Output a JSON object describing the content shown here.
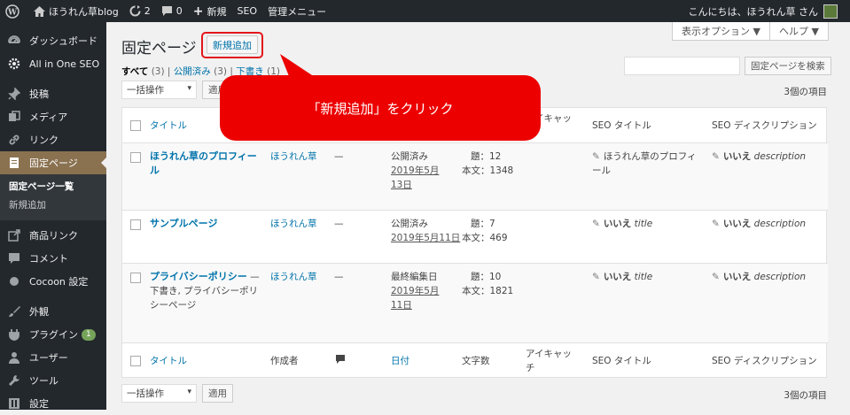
{
  "adminbar": {
    "site_name": "ほうれん草blog",
    "updates": "2",
    "comments": "0",
    "new_label": "新規",
    "seo": "SEO",
    "manage_menu": "管理メニュー",
    "greeting": "こんにちは、ほうれん草 さん"
  },
  "menu": {
    "items": [
      {
        "label": "ダッシュボード",
        "icon": "dashboard-icon"
      },
      {
        "label": "All in One SEO",
        "icon": "gear-icon"
      },
      {
        "label": "投稿",
        "icon": "pin-icon"
      },
      {
        "label": "メディア",
        "icon": "media-icon"
      },
      {
        "label": "リンク",
        "icon": "link-icon"
      },
      {
        "label": "固定ページ",
        "icon": "page-icon"
      }
    ],
    "submenu": [
      "固定ページ一覧",
      "新規追加"
    ],
    "items2": [
      {
        "label": "商品リンク",
        "icon": "external-link-icon"
      },
      {
        "label": "コメント",
        "icon": "comment-icon"
      },
      {
        "label": "Cocoon 設定",
        "icon": "circle-icon"
      }
    ],
    "items3": [
      {
        "label": "外観",
        "icon": "brush-icon"
      },
      {
        "label": "プラグイン",
        "icon": "plugin-icon",
        "badge": "1"
      },
      {
        "label": "ユーザー",
        "icon": "user-icon"
      },
      {
        "label": "ツール",
        "icon": "wrench-icon"
      },
      {
        "label": "設定",
        "icon": "settings-icon"
      }
    ]
  },
  "screen_options": "表示オプション ▼",
  "help": "ヘルプ ▼",
  "page": {
    "title": "固定ページ",
    "add_new": "新規追加"
  },
  "subsub": {
    "all": "すべて",
    "all_count": "(3)",
    "sep": "|",
    "published": "公開済み",
    "published_count": "(3)",
    "drafts": "下書き",
    "drafts_count": "(1)"
  },
  "search": {
    "button": "固定ページを検索",
    "value": ""
  },
  "bulk": {
    "label": "一括操作",
    "apply": "適用",
    "count": "3個の項目"
  },
  "columns": {
    "title": "タイトル",
    "author": "作成者",
    "date": "日付",
    "words": "文字数",
    "eyecatch": "アイキャッチ",
    "seo_title": "SEO タイトル",
    "seo_desc": "SEO ディスクリプション"
  },
  "rows": [
    {
      "title": "ほうれん草のプロフィール",
      "author": "ほうれん草",
      "comments": "—",
      "status": "公開済み",
      "date": "2019年5月13日",
      "heads": "題：12",
      "body": "本文：1348",
      "seo_title": "ほうれん草のプロフィール",
      "seo_desc_yes": "いいえ",
      "seo_desc": "description"
    },
    {
      "title": "サンプルページ",
      "author": "ほうれん草",
      "comments": "—",
      "status": "公開済み",
      "date": "2019年5月11日",
      "heads": "題：7",
      "body": "本文：469",
      "seo_title_yes": "いいえ",
      "seo_title": "title",
      "seo_desc_yes": "いいえ",
      "seo_desc": "description"
    },
    {
      "title": "プライバシーポリシー",
      "title_suffix": " — 下書き, プライバシーポリシーページ",
      "author": "ほうれん草",
      "comments": "—",
      "status": "最終編集日",
      "date": "2019年5月11日",
      "heads": "題：10",
      "body": "本文：1821",
      "seo_title_yes": "いいえ",
      "seo_title": "title",
      "seo_desc_yes": "いいえ",
      "seo_desc": "description"
    }
  ],
  "callout": {
    "text": "「新規追加」をクリック",
    "color": "#ec0000"
  }
}
